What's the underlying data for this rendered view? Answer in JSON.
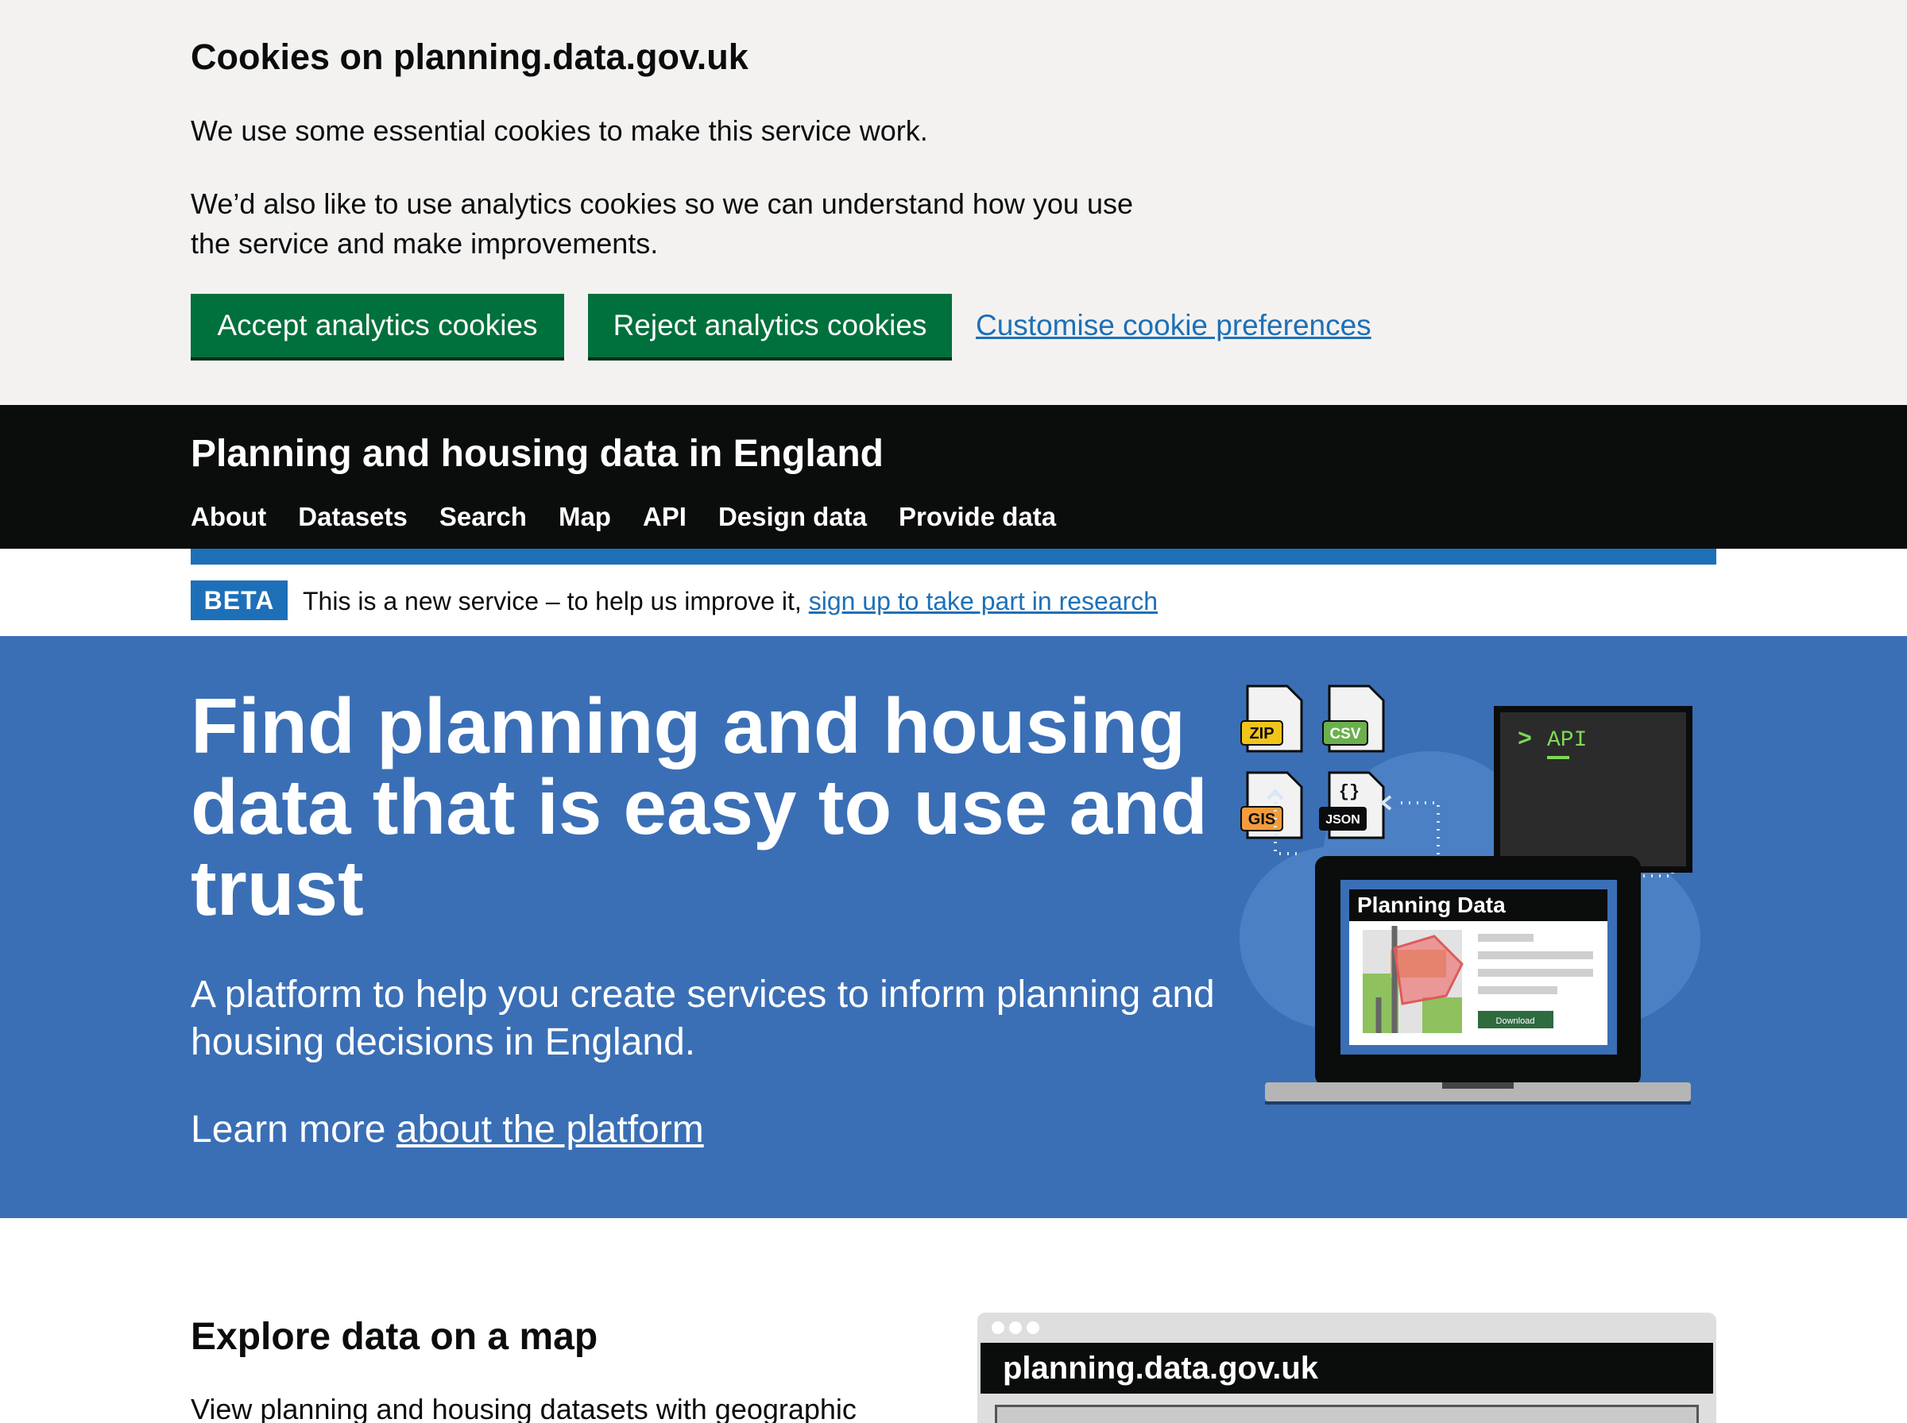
{
  "cookie_banner": {
    "title": "Cookies on planning.data.gov.uk",
    "para1": "We use some essential cookies to make this service work.",
    "para2": "We’d also like to use analytics cookies so we can understand how you use the service and make improvements.",
    "accept_label": "Accept analytics cookies",
    "reject_label": "Reject analytics cookies",
    "customise_label": "Customise cookie preferences"
  },
  "header": {
    "service_name": "Planning and housing data in England",
    "nav": [
      "About",
      "Datasets",
      "Search",
      "Map",
      "API",
      "Design data",
      "Provide data"
    ]
  },
  "phase_banner": {
    "tag": "BETA",
    "text": "This is a new service – to help us improve it, ",
    "link": "sign up to take part in research"
  },
  "hero": {
    "title": "Find planning and housing data that is easy to use and trust",
    "lead": "A platform to help you create services to inform planning and housing decisions in England.",
    "learn_prefix": "Learn more ",
    "learn_link": "about the platform",
    "illustration": {
      "file_badges": [
        "ZIP",
        "CSV",
        "GIS",
        "JSON"
      ],
      "json_glyph": "{}",
      "api_prompt": ">",
      "api_label": "API",
      "laptop_title": "Planning Data",
      "download_label": "Download"
    }
  },
  "explore": {
    "title": "Explore data on a map",
    "text": "View planning and housing datasets with geographic",
    "browser_url": "planning.data.gov.uk"
  },
  "colors": {
    "green": "#00703c",
    "link_blue": "#1d70b8",
    "hero_blue": "#3a6fb6",
    "black": "#0b0c0c"
  }
}
